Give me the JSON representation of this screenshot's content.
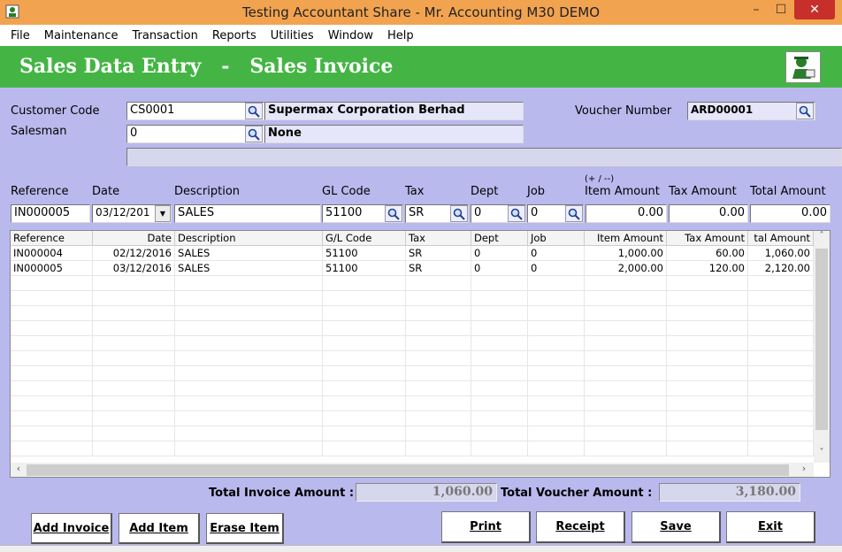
{
  "window": {
    "title": "Testing Accountant Share - Mr. Accounting M30 DEMO",
    "min": "–",
    "max": "☐",
    "close": "✕"
  },
  "menu": [
    "File",
    "Maintenance",
    "Transaction",
    "Reports",
    "Utilities",
    "Window",
    "Help"
  ],
  "header": {
    "title": "Sales Data Entry   -   Sales Invoice"
  },
  "customer": {
    "code_label": "Customer Code",
    "code": "CS0001",
    "name": "Supermax Corporation Berhad",
    "salesman_label": "Salesman",
    "salesman": "0",
    "salesman_name": "None",
    "extra": ""
  },
  "voucher": {
    "label": "Voucher Number",
    "number": "ARD00001"
  },
  "entry": {
    "labels": {
      "reference": "Reference",
      "date": "Date",
      "description": "Description",
      "gl_code": "GL Code",
      "tax": "Tax",
      "dept": "Dept",
      "job": "Job",
      "item_hint": "(+ / --)",
      "item_amount": "Item Amount",
      "tax_amount": "Tax Amount",
      "total_amount": "Total Amount"
    },
    "values": {
      "reference": "IN000005",
      "date": "03/12/201",
      "description": "SALES",
      "gl_code": "51100",
      "tax": "SR",
      "dept": "0",
      "job": "0",
      "item_amount": "0.00",
      "tax_amount": "0.00",
      "total_amount": "0.00"
    }
  },
  "grid": {
    "headers": [
      "Reference",
      "Date",
      "Description",
      "G/L Code",
      "Tax",
      "Dept",
      "Job",
      "Item Amount",
      "Tax Amount",
      "tal Amount"
    ],
    "rows": [
      [
        "IN000004",
        "02/12/2016",
        "SALES",
        "51100",
        "SR",
        "0",
        "0",
        "1,000.00",
        "60.00",
        "1,060.00"
      ],
      [
        "IN000005",
        "03/12/2016",
        "SALES",
        "51100",
        "SR",
        "0",
        "0",
        "2,000.00",
        "120.00",
        "2,120.00"
      ]
    ],
    "scroll_up": "˄",
    "scroll_down": "˅",
    "scroll_left": "‹",
    "scroll_right": "›"
  },
  "totals": {
    "invoice_label": "Total Invoice Amount :",
    "invoice_value": "1,060.00",
    "voucher_label": "Total  Voucher Amount :",
    "voucher_value": "3,180.00"
  },
  "buttons": {
    "add_invoice": "Add Invoice",
    "add_item": "Add Item",
    "erase_item": "Erase Item",
    "print": "Print",
    "receipt": "Receipt",
    "save": "Save",
    "exit": "Exit"
  }
}
